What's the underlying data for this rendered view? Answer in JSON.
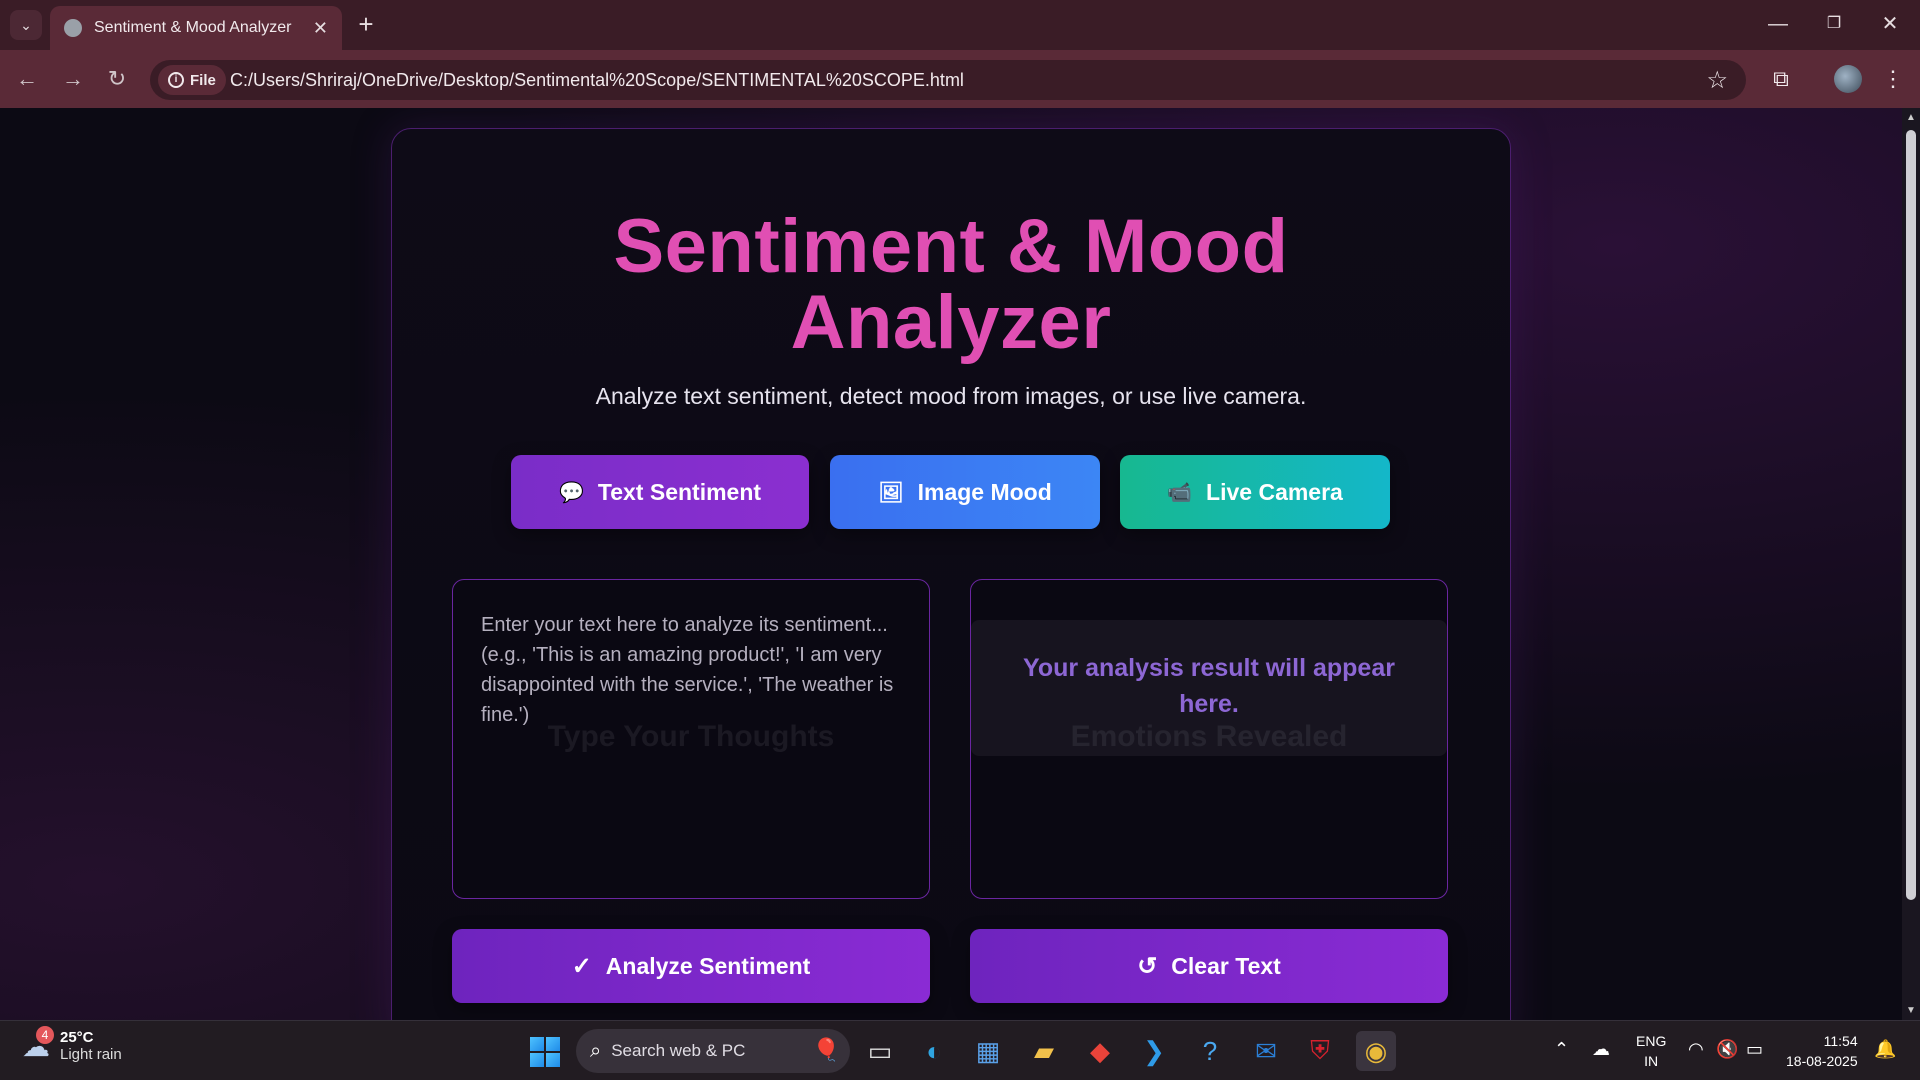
{
  "browser": {
    "tab_title": "Sentiment & Mood Analyzer",
    "chip_label": "File",
    "url": "C:/Users/Shriraj/OneDrive/Desktop/Sentimental%20Scope/SENTIMENTAL%20SCOPE.html"
  },
  "app": {
    "title_line1": "Sentiment & Mood",
    "title_line2": "Analyzer",
    "subtitle": "Analyze text sentiment, detect mood from images, or use live camera.",
    "modes": {
      "text": "Text Sentiment",
      "image": "Image Mood",
      "camera": "Live Camera"
    },
    "input": {
      "placeholder": "Enter your text here to analyze its sentiment... (e.g., 'This is an amazing product!', 'I am very disappointed with the service.', 'The weather is fine.')",
      "ghost_label": "Type Your Thoughts"
    },
    "result": {
      "text": "Your analysis result will appear here.",
      "ghost_label": "Emotions Revealed"
    },
    "actions": {
      "analyze": "Analyze Sentiment",
      "clear": "Clear Text"
    },
    "colors": {
      "title": "#e04fb3",
      "text_btn": "#7a2dc8",
      "image_btn": "#3a6ff0",
      "camera_btn": "#17b890",
      "result_text": "#8d67d4"
    }
  },
  "taskbar": {
    "weather_badge": "4",
    "temperature": "25°C",
    "condition": "Light rain",
    "search_placeholder": "Search web & PC",
    "lang_line1": "ENG",
    "lang_line2": "IN",
    "time": "11:54",
    "date": "18-08-2025"
  }
}
